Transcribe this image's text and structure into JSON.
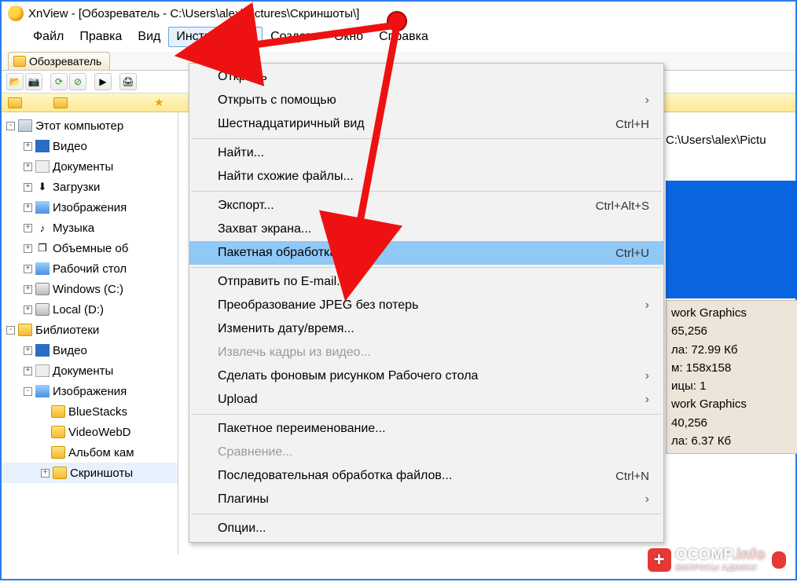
{
  "titlebar": {
    "text": "XnView - [Обозреватель - C:\\Users\\alex\\Pictures\\Скриншоты\\]"
  },
  "menubar": {
    "items": [
      "Файл",
      "Правка",
      "Вид",
      "Инструменты",
      "Создать",
      "Окно",
      "Справка"
    ],
    "open_index": 3
  },
  "tab": {
    "label": "Обозреватель"
  },
  "pathbar": {
    "visible_text": ""
  },
  "address_text": "C:\\Users\\alex\\Pictu",
  "tree": {
    "items": [
      {
        "ind": 0,
        "exp": "-",
        "icon": "pc",
        "label": "Этот компьютер"
      },
      {
        "ind": 1,
        "exp": "+",
        "icon": "vid",
        "label": "Видео"
      },
      {
        "ind": 1,
        "exp": "+",
        "icon": "doc",
        "label": "Документы"
      },
      {
        "ind": 1,
        "exp": "+",
        "icon": "dl",
        "label": "Загрузки"
      },
      {
        "ind": 1,
        "exp": "+",
        "icon": "img",
        "label": "Изображения"
      },
      {
        "ind": 1,
        "exp": "+",
        "icon": "music",
        "label": "Музыка"
      },
      {
        "ind": 1,
        "exp": "+",
        "icon": "3d",
        "label": "Объемные об"
      },
      {
        "ind": 1,
        "exp": "+",
        "icon": "img",
        "label": "Рабочий стол"
      },
      {
        "ind": 1,
        "exp": "+",
        "icon": "drive",
        "label": "Windows (C:)"
      },
      {
        "ind": 1,
        "exp": "+",
        "icon": "drive",
        "label": "Local (D:)"
      },
      {
        "ind": 0,
        "exp": "-",
        "icon": "folder",
        "label": "Библиотеки"
      },
      {
        "ind": 1,
        "exp": "+",
        "icon": "vid",
        "label": "Видео"
      },
      {
        "ind": 1,
        "exp": "+",
        "icon": "doc",
        "label": "Документы"
      },
      {
        "ind": 1,
        "exp": "-",
        "icon": "img",
        "label": "Изображения"
      },
      {
        "ind": 2,
        "exp": "",
        "icon": "folder",
        "label": "BlueStacks"
      },
      {
        "ind": 2,
        "exp": "",
        "icon": "folder",
        "label": "VideoWebD"
      },
      {
        "ind": 2,
        "exp": "",
        "icon": "folder",
        "label": "Альбом кам"
      },
      {
        "ind": 2,
        "exp": "+",
        "icon": "folder",
        "label": "Скриншоты",
        "sel": true
      }
    ]
  },
  "menu": {
    "items": [
      {
        "label": "Открыть"
      },
      {
        "label": "Открыть с помощью",
        "sub": true
      },
      {
        "label": "Шестнадцатиричный вид",
        "shortcut": "Ctrl+H"
      },
      {
        "sep": true
      },
      {
        "label": "Найти..."
      },
      {
        "label": "Найти схожие файлы..."
      },
      {
        "sep": true
      },
      {
        "label": "Экспорт...",
        "shortcut": "Ctrl+Alt+S"
      },
      {
        "label": "Захват экрана..."
      },
      {
        "label": "Пакетная обработка...",
        "shortcut": "Ctrl+U",
        "hl": true
      },
      {
        "sep": true
      },
      {
        "label": "Отправить по E-mail..."
      },
      {
        "label": "Преобразование JPEG без потерь",
        "sub": true
      },
      {
        "label": "Изменить дату/время..."
      },
      {
        "label": "Извлечь кадры из видео...",
        "disabled": true
      },
      {
        "label": "Сделать фоновым рисунком Рабочего стола",
        "sub": true
      },
      {
        "label": "Upload",
        "sub": true
      },
      {
        "sep": true
      },
      {
        "label": "Пакетное переименование..."
      },
      {
        "label": "Сравнение...",
        "disabled": true
      },
      {
        "label": "Последовательная обработка файлов...",
        "shortcut": "Ctrl+N"
      },
      {
        "label": "Плагины",
        "sub": true
      },
      {
        "sep": true
      },
      {
        "label": "Опции..."
      }
    ]
  },
  "info": {
    "lines": [
      "work Graphics",
      "65,256",
      "ла: 72.99 Кб",
      "м: 158x158",
      "ицы: 1",
      "work Graphics",
      "40,256",
      "ла: 6.37 Кб"
    ]
  },
  "watermark": {
    "brand": "OCOMP",
    "tld": ".info",
    "subtitle": "ВОПРОСЫ АДМИНУ"
  }
}
